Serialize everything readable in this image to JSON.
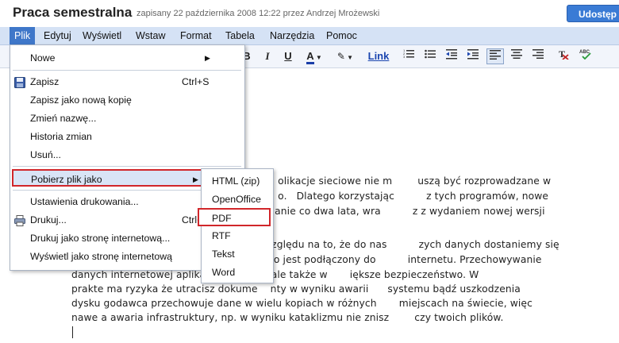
{
  "header": {
    "title": "Praca semestralna",
    "saved_info": "zapisany 22 października 2008 12:22 przez Andrzej Mrożewski",
    "share_button": "Udostęp"
  },
  "menubar": [
    "Plik",
    "Edytuj",
    "Wyświetl",
    "Wstaw",
    "Format",
    "Tabela",
    "Narzędzia",
    "Pomoc"
  ],
  "toolbar": {
    "bold": "B",
    "italic": "I",
    "underline": "U",
    "text_color": "A",
    "link": "Link"
  },
  "file_menu": {
    "new": "Nowe",
    "save": "Zapisz",
    "save_shortcut": "Ctrl+S",
    "save_copy": "Zapisz jako nową kopię",
    "rename": "Zmień nazwę...",
    "history": "Historia zmian",
    "delete": "Usuń...",
    "download_as": "Pobierz plik jako",
    "print_settings": "Ustawienia drukowania...",
    "print": "Drukuj...",
    "print_shortcut": "Ctrl+P",
    "print_web": "Drukuj jako stronę internetową...",
    "view_web": "Wyświetl jako stronę internetową"
  },
  "download_submenu": [
    "HTML (zip)",
    "OpenOffice",
    "PDF",
    "RTF",
    "Tekst",
    "Word"
  ],
  "document": {
    "lines": [
      "                  olikacje sieciowe nie m        uszą być rozprowadzane w",
      "                  o.   Dlatego korzystając          z tych programów, nowe",
      "                 anie co dwa lata, wra          z z wydaniem nowej wersji",
      "",
      "                zględu na to, że do nas          zych danych dostaniemy się",
      "               ko jest podłączony do          internetu. Przechowywanie",
      "danych internetowej aplikacji   wygoda, ale także w       iększe bezpieczeństwo. W",
      "prakte ma ryzyka że utracisz dokume    nty w wyniku awarii      systemu bądź uszkodzenia",
      "dysku godawca przechowuje dane w wielu kopiach w różnych       miejscach na świecie, więc",
      "nawe a awaria infrastruktury, np. w wyniku kataklizmu nie znisz        czy twoich plików."
    ]
  }
}
